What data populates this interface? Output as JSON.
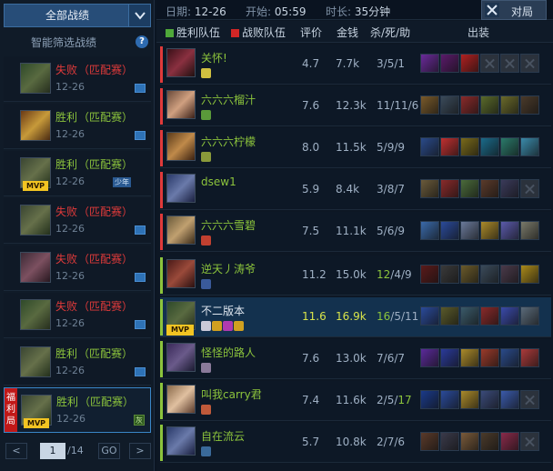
{
  "sidebar": {
    "all_records_label": "全部战绩",
    "smart_filter_label": "智能筛选战绩",
    "help_label": "?",
    "games": [
      {
        "result": "失败",
        "type": "lose",
        "mode": "（匹配赛）",
        "date": "12-26",
        "avatar": "c1",
        "mvp": "",
        "tag": ""
      },
      {
        "result": "胜利",
        "type": "win",
        "mode": "（匹配赛）",
        "date": "12-26",
        "avatar": "c2",
        "mvp": "",
        "tag": ""
      },
      {
        "result": "胜利",
        "type": "win",
        "mode": "（匹配赛）",
        "date": "12-26",
        "avatar": "c3",
        "mvp": "MVP",
        "tag": "少年"
      },
      {
        "result": "失败",
        "type": "lose",
        "mode": "（匹配赛）",
        "date": "12-26",
        "avatar": "c3",
        "mvp": "",
        "tag": ""
      },
      {
        "result": "失败",
        "type": "lose",
        "mode": "（匹配赛）",
        "date": "12-26",
        "avatar": "c4",
        "mvp": "",
        "tag": ""
      },
      {
        "result": "失败",
        "type": "lose",
        "mode": "（匹配赛）",
        "date": "12-26",
        "avatar": "c1",
        "mvp": "",
        "tag": ""
      },
      {
        "result": "胜利",
        "type": "win",
        "mode": "（匹配赛）",
        "date": "12-26",
        "avatar": "c3",
        "mvp": "",
        "tag": ""
      },
      {
        "result": "胜利",
        "type": "win",
        "mode": "（匹配赛）",
        "date": "12-26",
        "avatar": "c3",
        "mvp": "MVP",
        "tag": "灰",
        "welfare": "福利局"
      }
    ],
    "pager": {
      "prev": "<",
      "current": "1",
      "total": "/14",
      "go": "GO",
      "next": ">"
    }
  },
  "info": {
    "date_label": "日期:",
    "date": "12-26",
    "start_label": "开始:",
    "start": "05:59",
    "duration_label": "时长:",
    "duration": "35分钟",
    "exit_label": "对局"
  },
  "table_header": {
    "win_team": "胜利队伍",
    "lose_team": "战败队伍",
    "rating": "评价",
    "gold": "金钱",
    "kda": "杀/死/助",
    "items": "出装"
  },
  "colors": {
    "win": "#8cc43c",
    "lose": "#e03a3a",
    "accent": "#3a86c8",
    "mvp": "#f2c422"
  },
  "players": [
    {
      "name": "关怀!",
      "team": "lose",
      "rating": "4.7",
      "gold": "7.7k",
      "k": "3",
      "d": "5",
      "a": "1",
      "items": [
        "#6a2a9a",
        "#5a1a6a",
        "#b02020",
        "empty",
        "empty",
        "empty"
      ],
      "avatar": "linear-gradient(135deg,#3a1018,#8a3040,#201010)",
      "highlight": false
    },
    {
      "name": "六六六榴汁",
      "team": "lose",
      "rating": "7.6",
      "gold": "12.3k",
      "k": "11",
      "d": "11",
      "a": "6",
      "items": [
        "#7a5a2a",
        "#3a4a5a",
        "#8a2a2a",
        "#5a6a2a",
        "#6a6a2a",
        "#4a3a2a"
      ],
      "avatar": "linear-gradient(135deg,#6a4a3a,#d0a080,#3a2018)",
      "highlight": false
    },
    {
      "name": "六六六柠檬",
      "team": "lose",
      "rating": "8.0",
      "gold": "11.5k",
      "k": "5",
      "d": "9",
      "a": "9",
      "items": [
        "#2a4a8a",
        "#c03030",
        "#7a6a1a",
        "#1a6a8a",
        "#2a7a6a",
        "#3a8aaa"
      ],
      "avatar": "linear-gradient(135deg,#5a3a1a,#c08a4a,#3a2010)",
      "highlight": false
    },
    {
      "name": "dsew1",
      "team": "lose",
      "rating": "5.9",
      "gold": "8.4k",
      "k": "3",
      "d": "8",
      "a": "7",
      "items": [
        "#6a5a3a",
        "#8a2a2a",
        "#4a6a3a",
        "#5a3a2a",
        "#3a3a5a",
        "empty"
      ],
      "avatar": "linear-gradient(135deg,#2a3a6a,#6a7aaa,#1a2040)",
      "highlight": false
    },
    {
      "name": "六六六雪碧",
      "team": "lose",
      "rating": "7.5",
      "gold": "11.1k",
      "k": "5",
      "d": "6",
      "a": "9",
      "items": [
        "#3a6aaa",
        "#2a4a9a",
        "#6a7a9a",
        "#aa8a2a",
        "#5a5aaa",
        "#7a7a6a"
      ],
      "avatar": "linear-gradient(135deg,#6a5a3a,#c0a070,#3a2a18)",
      "highlight": false
    },
    {
      "name": "逆天丿涛爷",
      "team": "win",
      "rating": "11.2",
      "gold": "15.0k",
      "k": "12",
      "d": "4",
      "a": "9",
      "items": [
        "#5a1a1a",
        "#3a3a3a",
        "#6a5a2a",
        "#3a4a5a",
        "#4a3a4a",
        "#aa8a1a"
      ],
      "avatar": "linear-gradient(135deg,#4a1a18,#9a4a3a,#2a1010)",
      "highlight": false
    },
    {
      "name": "不二版本",
      "team": "win",
      "rating": "11.6",
      "gold": "16.9k",
      "k": "16",
      "d": "5",
      "a": "11",
      "items": [
        "#2a4a9a",
        "#5a5a2a",
        "#3a5a6a",
        "#8a2a2a",
        "#3a4aaa",
        "#5a6a7a"
      ],
      "avatar": "linear-gradient(135deg,#2f4a2a,#596a40,#262e1e)",
      "highlight": true,
      "mvp": "MVP"
    },
    {
      "name": "怪怪的路人",
      "team": "win",
      "rating": "7.6",
      "gold": "13.0k",
      "k": "7",
      "d": "6",
      "a": "7",
      "items": [
        "#5a2a9a",
        "#2a3a9a",
        "#aa8a2a",
        "#9a3a2a",
        "#2a4a8a",
        "#aa3a3a"
      ],
      "avatar": "linear-gradient(135deg,#3a2a5a,#6a5a8a,#1a1a30)",
      "highlight": false
    },
    {
      "name": "叫我carry君",
      "team": "win",
      "rating": "7.4",
      "gold": "11.6k",
      "k": "2",
      "d": "5",
      "a": "17",
      "items": [
        "#1a3a8a",
        "#2a4a9a",
        "#aa8a2a",
        "#3a4a7a",
        "#3a5aaa",
        "empty"
      ],
      "avatar": "linear-gradient(135deg,#8a6a4a,#e0c0a0,#5a3a2a)",
      "highlight": false
    },
    {
      "name": "自在流云",
      "team": "win",
      "rating": "5.7",
      "gold": "10.8k",
      "k": "2",
      "d": "7",
      "a": "6",
      "items": [
        "#5a3a2a",
        "#3a3a4a",
        "#7a5a3a",
        "#4a3a2a",
        "#8a2a4a",
        "empty"
      ],
      "avatar": "linear-gradient(135deg,#2a3a6a,#6a7aaa,#1a2040)",
      "highlight": false
    }
  ]
}
